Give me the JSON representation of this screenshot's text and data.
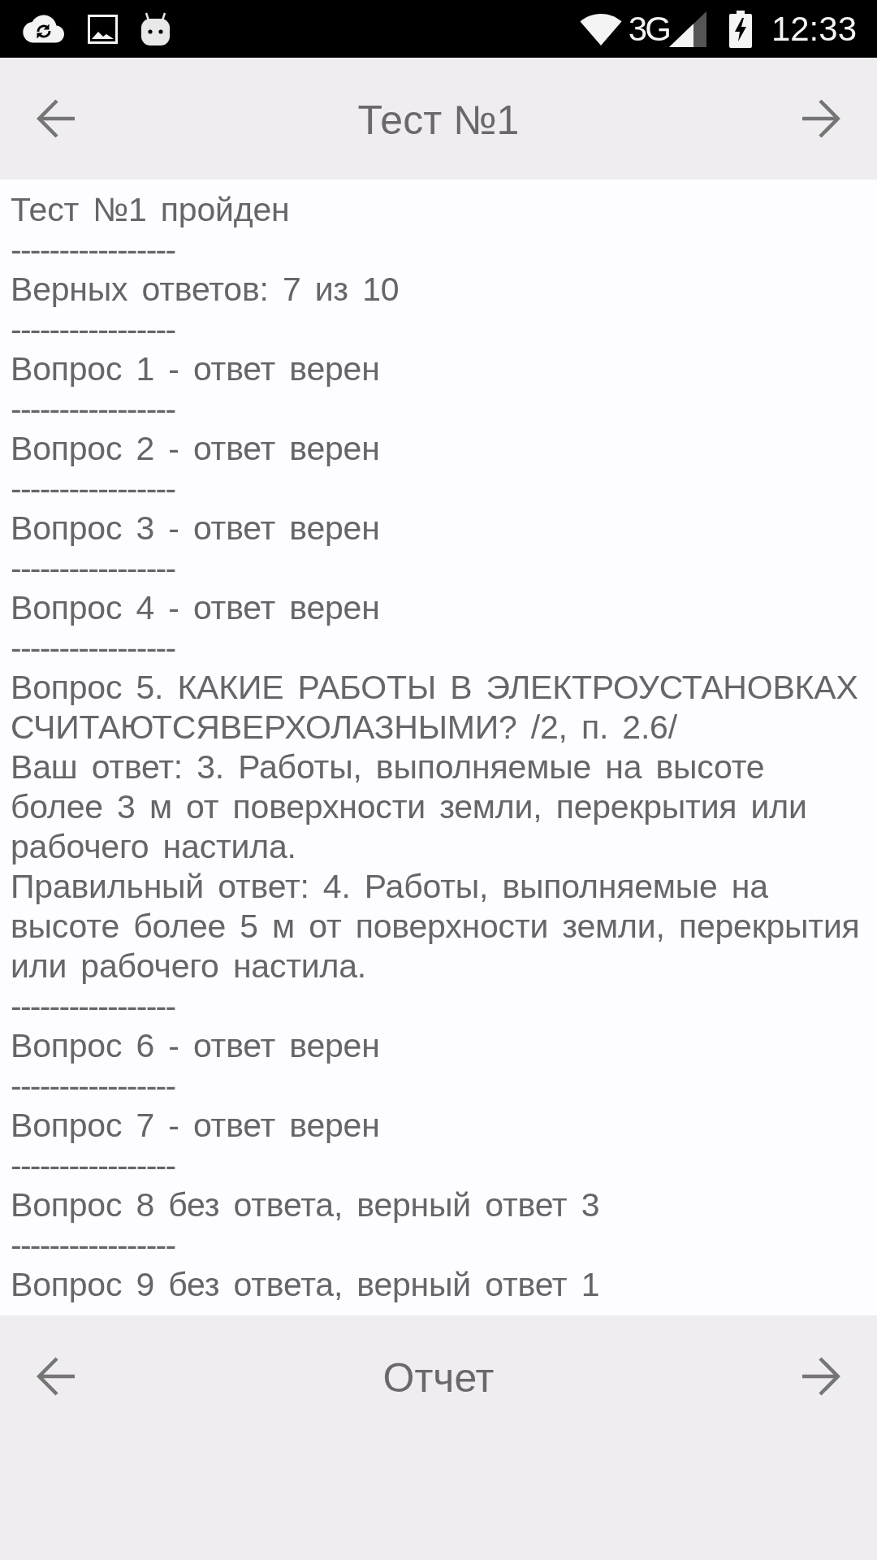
{
  "status_bar": {
    "network": "3G",
    "time": "12:33"
  },
  "top_bar": {
    "title": "Тест №1"
  },
  "report": [
    {
      "kind": "text",
      "text": "Тест №1 пройден"
    },
    {
      "kind": "separator",
      "text": "-----------------"
    },
    {
      "kind": "text",
      "text": "Верных ответов: 7 из 10"
    },
    {
      "kind": "separator",
      "text": "-----------------"
    },
    {
      "kind": "text",
      "text": "Вопрос 1 - ответ верен"
    },
    {
      "kind": "separator",
      "text": "-----------------"
    },
    {
      "kind": "text",
      "text": "Вопрос 2 - ответ верен"
    },
    {
      "kind": "separator",
      "text": "-----------------"
    },
    {
      "kind": "text",
      "text": "Вопрос 3 - ответ верен"
    },
    {
      "kind": "separator",
      "text": "-----------------"
    },
    {
      "kind": "text",
      "text": "Вопрос 4 - ответ верен"
    },
    {
      "kind": "separator",
      "text": "-----------------"
    },
    {
      "kind": "text",
      "text": "Вопрос 5. КАКИЕ РАБОТЫ В ЭЛЕКТРОУСТАНОВКАХ СЧИТАЮТСЯВЕРХОЛАЗНЫМИ? /2, п. 2.6/"
    },
    {
      "kind": "text",
      "text": "Ваш ответ: 3. Работы, выполняемые на высоте более 3 м от поверхности земли, перекрытия или рабочего настила."
    },
    {
      "kind": "text",
      "text": "Правильный ответ: 4. Работы, выполняемые на высоте более 5 м от поверхности земли, перекрытия или рабочего настила."
    },
    {
      "kind": "separator",
      "text": "-----------------"
    },
    {
      "kind": "text",
      "text": "Вопрос 6 - ответ верен"
    },
    {
      "kind": "separator",
      "text": "-----------------"
    },
    {
      "kind": "text",
      "text": "Вопрос 7 - ответ верен"
    },
    {
      "kind": "separator",
      "text": "-----------------"
    },
    {
      "kind": "text",
      "text": "Вопрос 8 без ответа, верный ответ 3"
    },
    {
      "kind": "separator",
      "text": "-----------------"
    },
    {
      "kind": "text",
      "text": "Вопрос 9 без ответа, верный ответ 1"
    }
  ],
  "bottom_bar": {
    "title": "Отчет"
  }
}
